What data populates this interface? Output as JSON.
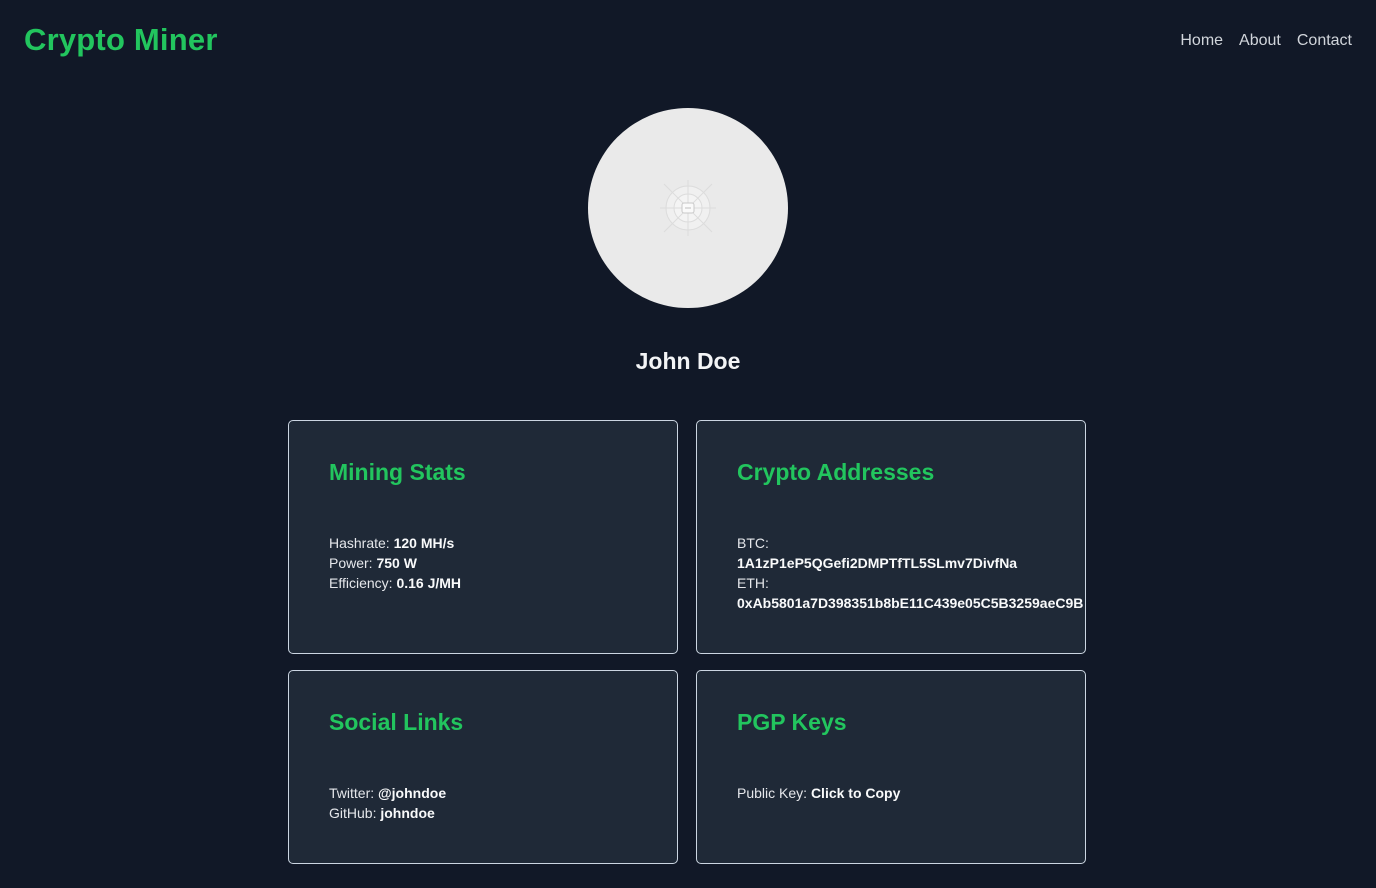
{
  "header": {
    "brand": "Crypto Miner",
    "nav": [
      "Home",
      "About",
      "Contact"
    ]
  },
  "profile": {
    "name": "John Doe",
    "avatar_icon": "image-placeholder-icon"
  },
  "cards": {
    "mining": {
      "title": "Mining Stats",
      "hashrate_label": "Hashrate:",
      "hashrate_value": "120 MH/s",
      "power_label": "Power:",
      "power_value": "750 W",
      "efficiency_label": "Efficiency:",
      "efficiency_value": "0.16 J/MH"
    },
    "addresses": {
      "title": "Crypto Addresses",
      "btc_label": "BTC:",
      "btc_value": "1A1zP1eP5QGefi2DMPTfTL5SLmv7DivfNa",
      "eth_label": "ETH:",
      "eth_value": "0xAb5801a7D398351b8bE11C439e05C5B3259aeC9B"
    },
    "social": {
      "title": "Social Links",
      "twitter_label": "Twitter:",
      "twitter_value": "@johndoe",
      "github_label": "GitHub:",
      "github_value": "johndoe"
    },
    "pgp": {
      "title": "PGP Keys",
      "pubkey_label": "Public Key:",
      "pubkey_action": "Click to Copy"
    }
  },
  "colors": {
    "background": "#111827",
    "card": "#1f2937",
    "accent": "#22c55e"
  }
}
